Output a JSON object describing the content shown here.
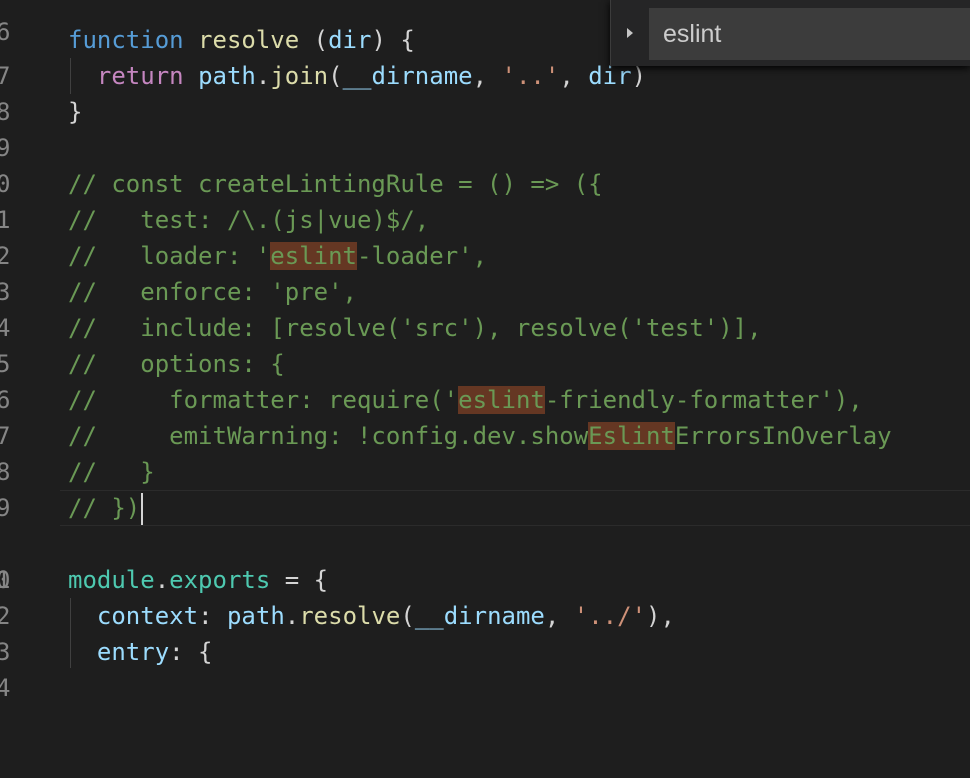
{
  "find": {
    "query": "eslint",
    "toggle_icon": "chevron-right-icon"
  },
  "colors": {
    "background": "#1e1e1e",
    "keyword": "#569cd6",
    "control_keyword": "#c586c0",
    "function": "#dcdcaa",
    "variable": "#9cdcfe",
    "string": "#ce9178",
    "comment": "#6a9955",
    "match_highlight": "#653723"
  },
  "gutter": [
    "6",
    "7",
    "8",
    "9",
    "0",
    "1",
    "2",
    "3",
    "4",
    "5",
    "6",
    "7",
    "8",
    "9",
    "0",
    "1",
    "2",
    "3",
    "4"
  ],
  "lines": [
    {
      "t": ""
    },
    {
      "t": "function resolve (dir) {"
    },
    {
      "t": "  return path.join(__dirname, '..', dir)"
    },
    {
      "t": "}"
    },
    {
      "t": ""
    },
    {
      "t": "// const createLintingRule = () => ({"
    },
    {
      "t": "//   test: /\\.(js|vue)$/,"
    },
    {
      "t": "//   loader: 'eslint-loader',"
    },
    {
      "t": "//   enforce: 'pre',"
    },
    {
      "t": "//   include: [resolve('src'), resolve('test')],"
    },
    {
      "t": "//   options: {"
    },
    {
      "t": "//     formatter: require('eslint-friendly-formatter'),"
    },
    {
      "t": "//     emitWarning: !config.dev.showEslintErrorsInOverlay"
    },
    {
      "t": "//   }"
    },
    {
      "t": "// })"
    },
    {
      "t": ""
    },
    {
      "t": "module.exports = {"
    },
    {
      "t": "  context: path.resolve(__dirname, '../'),"
    },
    {
      "t": "  entry: {"
    }
  ]
}
